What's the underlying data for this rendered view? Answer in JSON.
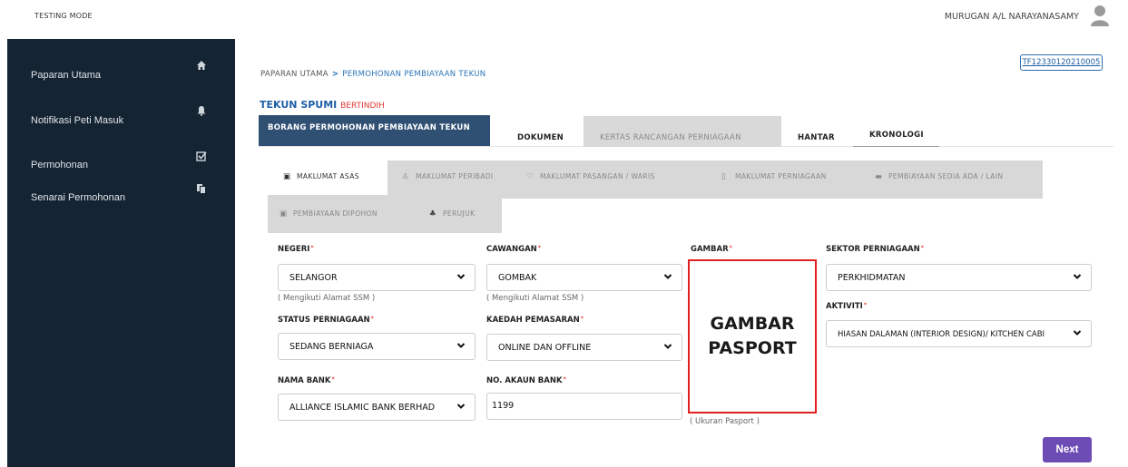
{
  "header": {
    "mode_label": "TESTING MODE",
    "user_name": "MURUGAN A/L NARAYANASAMY"
  },
  "sidebar": {
    "items": [
      {
        "label": "Paparan Utama",
        "icon": "home-icon"
      },
      {
        "label": "Notifikasi Peti Masuk",
        "icon": "bell-icon"
      },
      {
        "label": "Permohonan",
        "icon": "checkbox-icon"
      },
      {
        "label": "Senarai Permohonan",
        "icon": "copy-icon"
      }
    ]
  },
  "ref_number": "TF12330120210005",
  "breadcrumb": {
    "home": "PAPARAN UTAMA",
    "separator": ">",
    "current": "PERMOHONAN PEMBIAYAAN TEKUN"
  },
  "page_title": {
    "main": "TEKUN SPUMI",
    "sub": "BERTINDIH"
  },
  "tabs": {
    "main": "BORANG PERMOHONAN PEMBIAYAAN TEKUN",
    "dokumen": "DOKUMEN",
    "kertas": "KERTAS RANCANGAN PERNIAGAAN",
    "hantar": "HANTAR",
    "kronologi": "KRONOLOGI"
  },
  "subtabs": [
    {
      "label": "MAKLUMAT ASAS",
      "icon": "id-card-icon"
    },
    {
      "label": "MAKLUMAT PERIBADI",
      "icon": "user-icon"
    },
    {
      "label": "MAKLUMAT PASANGAN / WARIS",
      "icon": "heart-icon"
    },
    {
      "label": "MAKLUMAT PERNIAGAAN",
      "icon": "building-icon"
    },
    {
      "label": "PEMBIAYAAN SEDIA ADA / LAIN",
      "icon": "credit-card-icon"
    },
    {
      "label": "PEMBIAYAAN DIPOHON",
      "icon": "money-icon"
    },
    {
      "label": "PERUJUK",
      "icon": "user-plus-icon"
    }
  ],
  "form": {
    "negeri": {
      "label": "NEGERI",
      "value": "SELANGOR",
      "hint": "( Mengikuti Alamat SSM )"
    },
    "cawangan": {
      "label": "CAWANGAN",
      "value": "GOMBAK",
      "hint": "( Mengikuti Alamat SSM )"
    },
    "gambar": {
      "label": "GAMBAR",
      "placeholder": "GAMBAR PASPORT",
      "hint": "( Ukuran Pasport )"
    },
    "sektor": {
      "label": "SEKTOR PERNIAGAAN",
      "value": "PERKHIDMATAN"
    },
    "aktiviti": {
      "label": "AKTIVITI",
      "value": "HIASAN DALAMAN (INTERIOR DESIGN)/ KITCHEN CABI"
    },
    "status": {
      "label": "STATUS PERNIAGAAN",
      "value": "SEDANG BERNIAGA"
    },
    "kaedah": {
      "label": "KAEDAH PEMASARAN",
      "value": "ONLINE DAN OFFLINE"
    },
    "bank": {
      "label": "NAMA BANK",
      "value": "ALLIANCE ISLAMIC BANK BERHAD"
    },
    "akaun": {
      "label": "NO. AKAUN BANK",
      "value": "1199"
    },
    "required_mark": "*"
  },
  "next_button": "Next",
  "colors": {
    "sidebar": "#152433",
    "primary_tab": "#2f4f73",
    "button": "#6d4cb5",
    "required": "#e53935",
    "photo_border": "#e02020"
  }
}
